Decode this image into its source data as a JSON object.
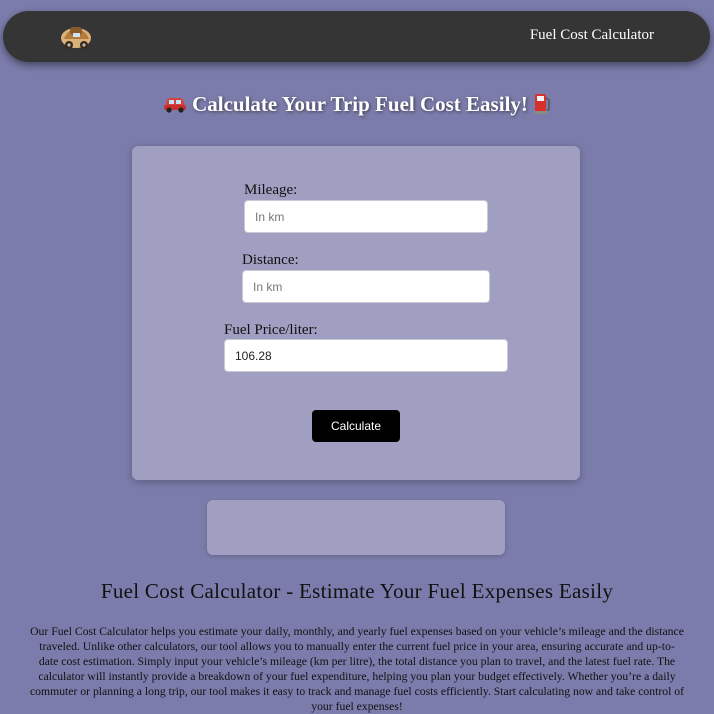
{
  "header": {
    "logo_icon": "car-logo-icon",
    "nav_title": "Fuel Cost Calculator"
  },
  "hero": {
    "icon_left": "car-emoji-icon",
    "title": "Calculate Your Trip Fuel Cost Easily!",
    "icon_right": "fuel-pump-emoji-icon"
  },
  "form": {
    "mileage": {
      "label": "Mileage:",
      "placeholder": "In km",
      "value": ""
    },
    "distance": {
      "label": "Distance:",
      "placeholder": "In km",
      "value": ""
    },
    "fuel_price": {
      "label": "Fuel Price/liter:",
      "placeholder": "",
      "value": "106.28"
    },
    "calculate_label": "Calculate"
  },
  "result": {
    "text": ""
  },
  "article": {
    "title": "Fuel Cost Calculator - Estimate Your Fuel Expenses Easily",
    "body": "Our Fuel Cost Calculator helps you estimate your daily, monthly, and yearly fuel expenses based on your vehicle’s mileage and the distance traveled. Unlike other calculators, our tool allows you to manually enter the current fuel price in your area, ensuring accurate and up-to-date cost estimation. Simply input your vehicle’s mileage (km per litre), the total distance you plan to travel, and the latest fuel rate. The calculator will instantly provide a breakdown of your fuel expenditure, helping you plan your budget effectively. Whether you’re a daily commuter or planning a long trip, our tool makes it easy to track and manage fuel costs efficiently. Start calculating now and take control of your fuel expenses!"
  },
  "colors": {
    "page_bg": "#7b7cab",
    "navbar_bg": "#353535",
    "card_bg": "#a09fc2",
    "button_bg": "#000000"
  }
}
